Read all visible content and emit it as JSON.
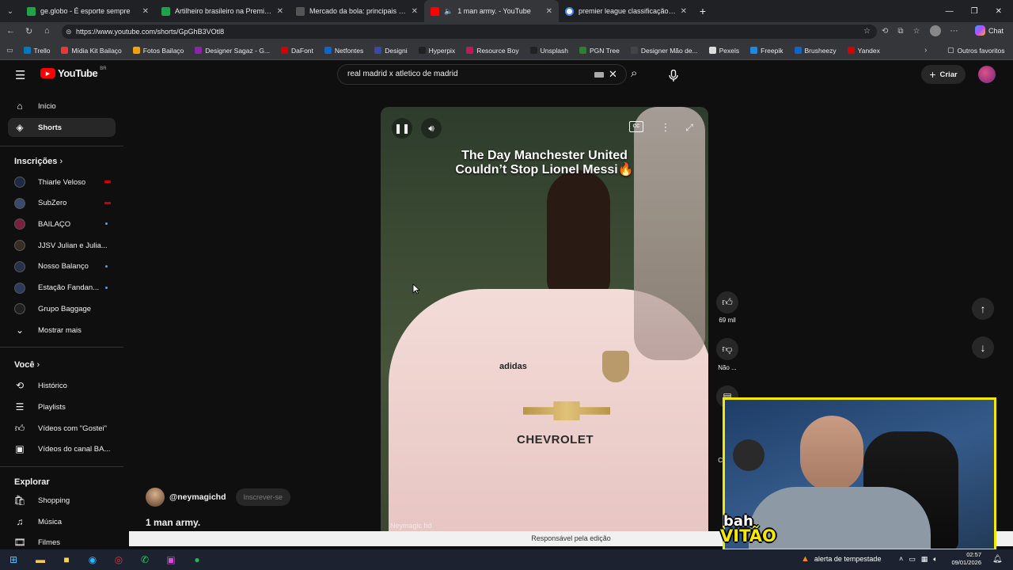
{
  "tabs": [
    {
      "title": "ge.globo - É esporte sempre",
      "color": "#1fa34a"
    },
    {
      "title": "Artilheiro brasileiro na Premier League",
      "color": "#1fa34a"
    },
    {
      "title": "Mercado da bola: principais transferências",
      "color": "#333333"
    },
    {
      "title": "1 man army. - YouTube",
      "color": "#ff0000"
    },
    {
      "title": "premier league classificação - Pesquisa",
      "color": "#4285f4"
    }
  ],
  "address": {
    "url": "https://www.youtube.com/shorts/GpGhB3VOtl8"
  },
  "bookmarks": [
    "Trello",
    "Mídia Kit Bailaço",
    "Fotos Bailaço",
    "Designer Sagaz - G...",
    "DaFont",
    "Netfontes",
    "Designi",
    "Hyperpix",
    "Resource Boy",
    "Unsplash",
    "PGN Tree",
    "Designer Mão de...",
    "Pexels",
    "Freepik",
    "Brusheezy",
    "Yandex"
  ],
  "bookmarks_other": "Outros favoritos",
  "chrome_chat": "Chat",
  "yt": {
    "logo": "YouTube",
    "region": "BR",
    "search_value": "real madrid x atletico de madrid",
    "create_label": "Criar",
    "nav": {
      "home": "Início",
      "shorts": "Shorts"
    },
    "subs_title": "Inscrições",
    "subs": [
      {
        "name": "Thiarle Veloso",
        "badge": "live"
      },
      {
        "name": "SubZero",
        "badge": "live"
      },
      {
        "name": "BAILAÇO",
        "badge": "dot"
      },
      {
        "name": "JJSV Julian e Julia...",
        "badge": "none"
      },
      {
        "name": "Nosso Balanço",
        "badge": "dot"
      },
      {
        "name": "Estação Fandan...",
        "badge": "dot"
      },
      {
        "name": "Grupo Baggage",
        "badge": "none"
      }
    ],
    "show_more": "Mostrar mais",
    "you_title": "Você",
    "you_items": [
      "Histórico",
      "Playlists",
      "Vídeos com \"Gostei\"",
      "Vídeos do canal BA..."
    ],
    "explore_title": "Explorar",
    "explore_items": [
      "Shopping",
      "Música",
      "Filmes"
    ],
    "video": {
      "caption_line1": "The Day Manchester United",
      "caption_line2": "Couldn’t Stop Lionel Messi🔥",
      "watermark": "Neymagic hd",
      "channel": "@neymagichd",
      "subscribe": "Inscrever-se",
      "title": "1 man army."
    },
    "actions": {
      "likes": "69 mil",
      "dislike": "Não ...",
      "comments": "Com..."
    },
    "footer": "Responsável pela edição"
  },
  "webcam": {
    "logo_line1": "bah",
    "logo_line2": "VITÃO"
  },
  "taskbar": {
    "weather": "alerta de tempestade",
    "time": "02:57",
    "date": "09/01/2026"
  }
}
